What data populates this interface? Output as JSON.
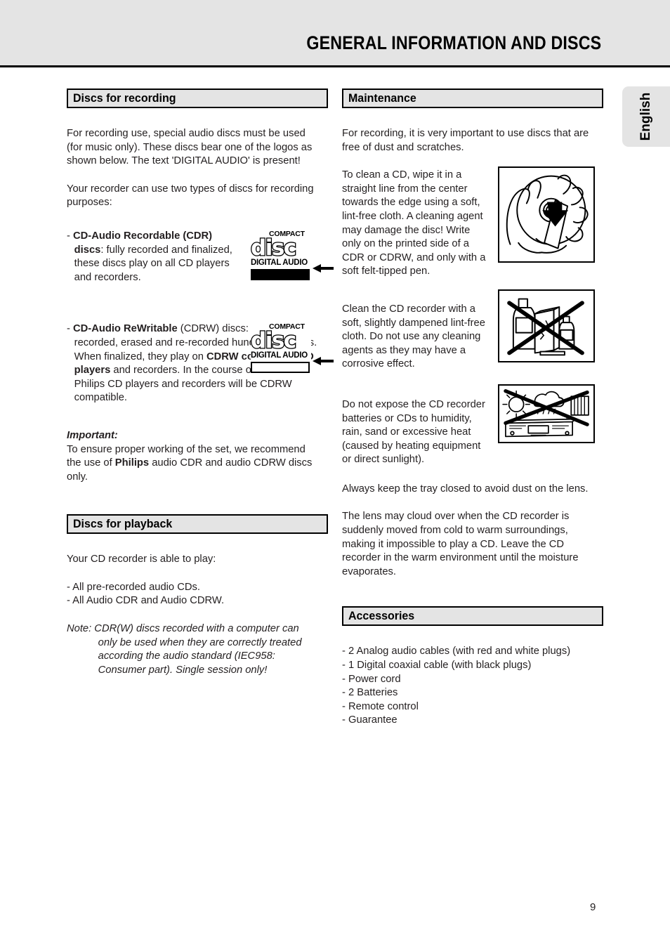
{
  "page": {
    "header_title": "GENERAL INFORMATION AND DISCS",
    "language_tab": "English",
    "page_number": "9",
    "header_bg": "#e4e4e4",
    "section_bar_bg": "#e4e4e4"
  },
  "left_column": {
    "section1": {
      "heading": "Discs for recording",
      "para1": "For recording use, special audio discs must be used (for music only). These discs bear one of the logos as shown below. The text 'DIGITAL AUDIO' is present!",
      "para2": "Your recorder can use two types of discs for recording purposes:",
      "bullet1": {
        "dash": "-",
        "bold_lead": "CD-Audio Recordable (CDR) discs",
        "rest": ": fully recorded and finalized, these discs play on all CD players and recorders.",
        "logo": {
          "compact": "COMPACT",
          "disc": "disc",
          "digital_audio": "DIGITAL AUDIO",
          "bar_style": "filled"
        }
      },
      "bullet2": {
        "dash": "-",
        "bold_lead": "CD-Audio ReWritable",
        "mid": " (CDRW) discs: can be recorded, erased and re-recorded hundreds of times. When finalized, they play on ",
        "bold_mid": "CDRW compatible CD players",
        "rest": " and recorders. In the course of 1999 most Philips CD players and recorders will be CDRW compatible.",
        "logo": {
          "compact": "COMPACT",
          "disc": "disc",
          "digital_audio": "DIGITAL AUDIO",
          "bar_style": "hollow"
        }
      },
      "important_heading": "Important:",
      "important_pre": "To ensure proper working of the set, we recommend the use of ",
      "important_bold": "Philips",
      "important_post": " audio CDR and audio CDRW discs only."
    },
    "section2": {
      "heading": "Discs for playback",
      "para1": "Your CD recorder is able to play:",
      "list_item1": "- All pre-recorded audio CDs.",
      "list_item2": "- All Audio CDR and Audio CDRW.",
      "note": "Note: CDR(W) discs recorded with a computer can only be used when they are correctly treated according the audio standard (IEC958: Consumer part). Single session only!"
    }
  },
  "right_column": {
    "section1": {
      "heading": "Maintenance",
      "para1": "For recording, it is very important to use discs that are free of dust and scratches.",
      "para2": "To clean a CD, wipe it in a straight line from the center towards the edge using a soft, lint-free cloth. A cleaning agent may damage the disc! Write only on the printed side of a CDR or CDRW, and only with a soft felt-tipped pen.",
      "para3": "Clean the CD recorder with a soft, slightly dampened lint-free cloth. Do not use any cleaning agents as they may have a corrosive effect.",
      "para4": "Do not expose the CD recorder batteries or CDs to humidity, rain, sand or excessive heat (caused by heating equipment or direct sunlight).",
      "para5": "Always keep the tray closed to avoid dust on the lens.",
      "para6": "The lens may cloud over when the CD recorder is suddenly moved from cold to warm surroundings, making it impossible to play a CD. Leave the CD recorder in the warm environment until the moisture evaporates."
    },
    "section2": {
      "heading": "Accessories",
      "items": [
        "- 2 Analog audio cables (with red and white plugs)",
        "- 1 Digital coaxial cable (with black plugs)",
        "- Power cord",
        "- 2 Batteries",
        "- Remote control",
        "- Guarantee"
      ]
    },
    "illustrations": [
      {
        "name": "cd-cleaning-illustration",
        "caption": "hand wiping a CD from center to edge with a cloth"
      },
      {
        "name": "no-cleaning-agents-illustration",
        "caption": "bottles of cleaning agents crossed out"
      },
      {
        "name": "no-heat-humidity-illustration",
        "caption": "sun, rain cloud and radiator near a CD recorder crossed out"
      }
    ]
  }
}
